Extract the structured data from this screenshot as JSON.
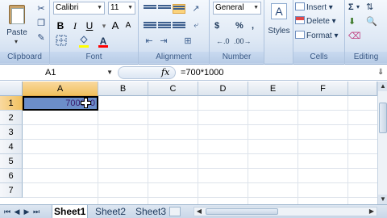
{
  "ribbon": {
    "clipboard": {
      "paste_label": "Paste",
      "group_label": "Clipboard"
    },
    "font": {
      "font_name": "Calibri",
      "font_size": "11",
      "bold": "B",
      "italic": "I",
      "underline": "U",
      "grow": "A",
      "shrink": "A",
      "color_letter": "A",
      "group_label": "Font"
    },
    "alignment": {
      "group_label": "Alignment"
    },
    "number": {
      "format": "General",
      "currency": "$",
      "percent": "%",
      "comma": ",",
      "group_label": "Number"
    },
    "styles": {
      "label": "Styles"
    },
    "cells": {
      "insert": "Insert",
      "delete": "Delete",
      "format": "Format",
      "group_label": "Cells"
    },
    "editing": {
      "sum": "Σ",
      "group_label": "Editing"
    },
    "colors": {
      "fill": "#ffff00",
      "font_color": "#ff0000",
      "highlight": "#fbd37c"
    }
  },
  "formula_bar": {
    "name_box": "A1",
    "fx": "fx",
    "formula": "=700*1000"
  },
  "grid": {
    "columns": [
      "A",
      "B",
      "C",
      "D",
      "E",
      "F"
    ],
    "rows": [
      "1",
      "2",
      "3",
      "4",
      "5",
      "6",
      "7"
    ],
    "active_cell_display": "700000",
    "selected_column": "A",
    "selected_row": "1"
  },
  "sheets": {
    "tabs": [
      "Sheet1",
      "Sheet2",
      "Sheet3"
    ],
    "active": "Sheet1"
  }
}
